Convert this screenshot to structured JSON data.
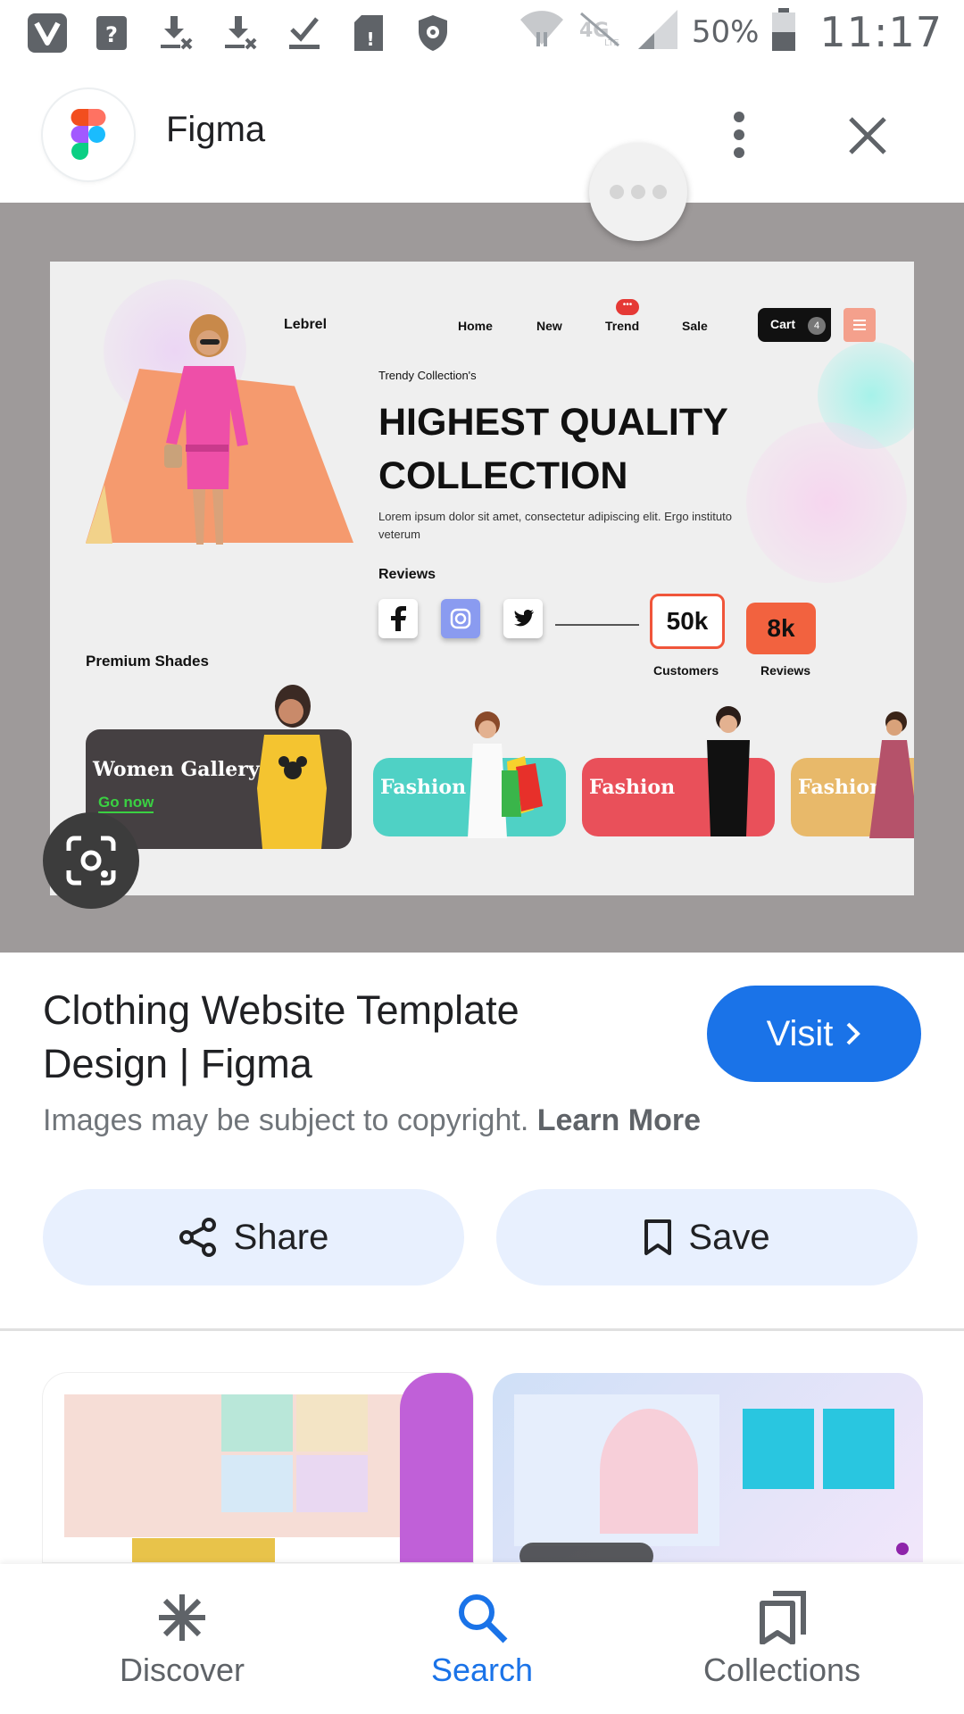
{
  "status_bar": {
    "battery": "50%",
    "time": "11:17",
    "left_icons": [
      "vivaldi-icon",
      "help-icon",
      "download-failed-icon",
      "download-failed-icon",
      "download-done-icon",
      "sim-alert-icon",
      "shield-icon"
    ],
    "right_icons": [
      "wifi-icon",
      "no-lte-icon",
      "signal-icon",
      "battery-icon"
    ]
  },
  "header": {
    "site_name": "Figma",
    "logo": "figma-logo"
  },
  "preview": {
    "brand": "Lebrel",
    "nav": [
      "Home",
      "New",
      "Trend",
      "Sale"
    ],
    "cart_label": "Cart",
    "cart_count": "4",
    "tagline": "Trendy Collection's",
    "headline": "HIGHEST QUALITY COLLECTION",
    "body": "Lorem ipsum dolor sit amet, consectetur adipiscing elit. Ergo instituto veterum",
    "reviews_label": "Reviews",
    "stat1_value": "50k",
    "stat1_label": "Customers",
    "stat2_value": "8k",
    "stat2_label": "Reviews",
    "premium": "Premium Shades",
    "gallery_title": "Women Gallery",
    "gallery_link": "Go now",
    "cards": [
      "Fashion",
      "Fashion",
      "Fashion"
    ],
    "card_colors": [
      "#4fd1c5",
      "#e9505a",
      "#e8b96a"
    ],
    "accent_orange": "#f59a6e"
  },
  "result": {
    "title": "Clothing Website Template Design | Figma",
    "visit_label": "Visit",
    "copyright_text": "Images may be subject to copyright.",
    "learn_more": "Learn More",
    "share_label": "Share",
    "save_label": "Save",
    "accent": "#1a73e8"
  },
  "bottom_nav": {
    "items": [
      {
        "label": "Discover",
        "icon": "asterisk-icon",
        "active": false
      },
      {
        "label": "Search",
        "icon": "search-icon",
        "active": true
      },
      {
        "label": "Collections",
        "icon": "collections-icon",
        "active": false
      }
    ]
  }
}
